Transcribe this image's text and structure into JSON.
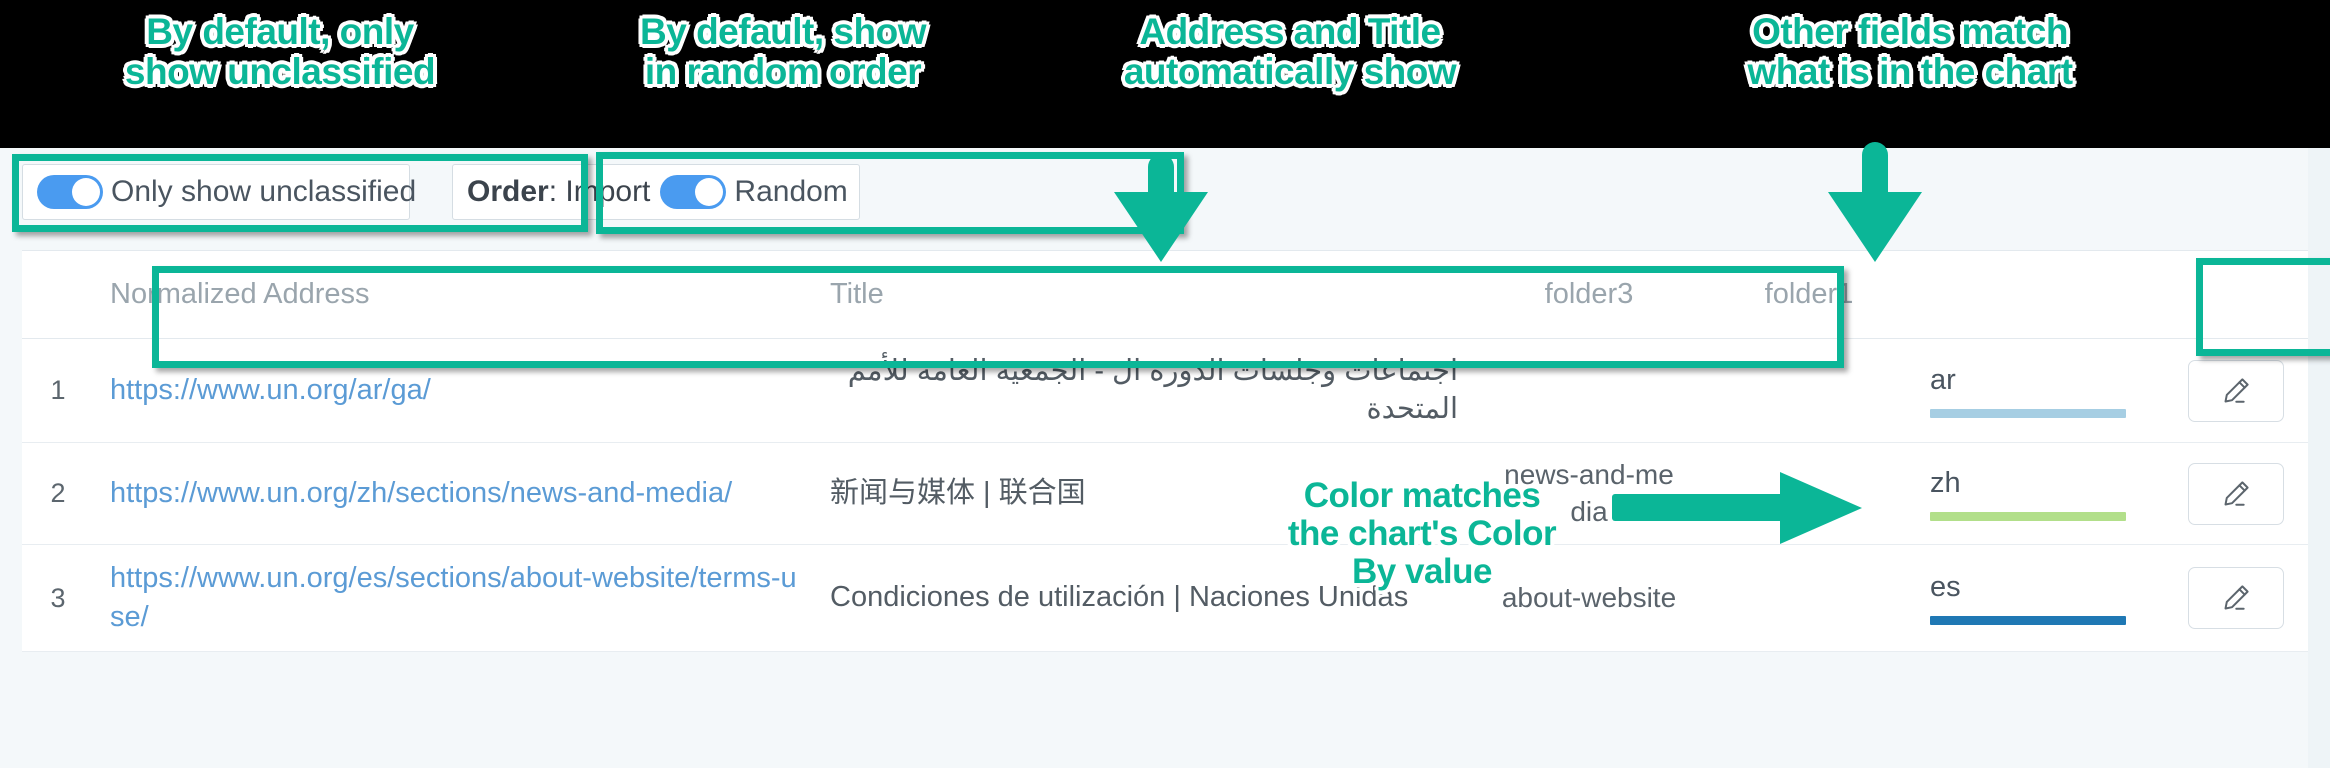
{
  "annotations": [
    {
      "id": "anno-unclassified",
      "text": "By default, only\nshow unclassified"
    },
    {
      "id": "anno-random-order",
      "text": "By default, show\nin random order"
    },
    {
      "id": "anno-address-title",
      "text": "Address and Title\nautomatically show"
    },
    {
      "id": "anno-other-fields",
      "text": "Other fields match\nwhat is in the chart"
    },
    {
      "id": "anno-color-match",
      "text": "Color matches\nthe chart's Color\nBy value"
    }
  ],
  "toolbar": {
    "unclassified_toggle_label": "Only show unclassified",
    "unclassified_toggle_on": true,
    "order_prefix_bold": "Order",
    "order_prefix_rest": ": Import",
    "order_right_label": "Random",
    "order_toggle_on": true
  },
  "table": {
    "headers": {
      "index": "",
      "address": "Normalized Address",
      "title": "Title",
      "folder3": "folder3",
      "folder1": "folder1",
      "color": "",
      "edit": ""
    },
    "rows": [
      {
        "index": "1",
        "address": "https://www.un.org/ar/ga/",
        "title": "اجتماعات وجلسات الدورة ال - الجمعية العامة للأمم المتحدة",
        "rtl": true,
        "folder3": "",
        "folder1": "",
        "color_key": "ar",
        "color_hex": "#a6cee3",
        "edit_icon": "pencil-icon"
      },
      {
        "index": "2",
        "address": "https://www.un.org/zh/sections/news-and-media/",
        "title": "新闻与媒体 | 联合国",
        "rtl": false,
        "folder3": "news-and-me dia",
        "folder1": "",
        "color_key": "zh",
        "color_hex": "#b2df8a",
        "edit_icon": "pencil-icon"
      },
      {
        "index": "3",
        "address": "https://www.un.org/es/sections/about-website/terms-use/",
        "title": "Condiciones de utilización | Naciones Unidas",
        "rtl": false,
        "folder3": "about-website",
        "folder1": "",
        "color_key": "es",
        "color_hex": "#1f78b4",
        "edit_icon": "pencil-icon"
      }
    ]
  },
  "colors": {
    "annotation_accent": "#0bb697",
    "toggle_on": "#4a9bf0",
    "link": "#5b9bd5",
    "page_background": "#f4f8fa"
  }
}
